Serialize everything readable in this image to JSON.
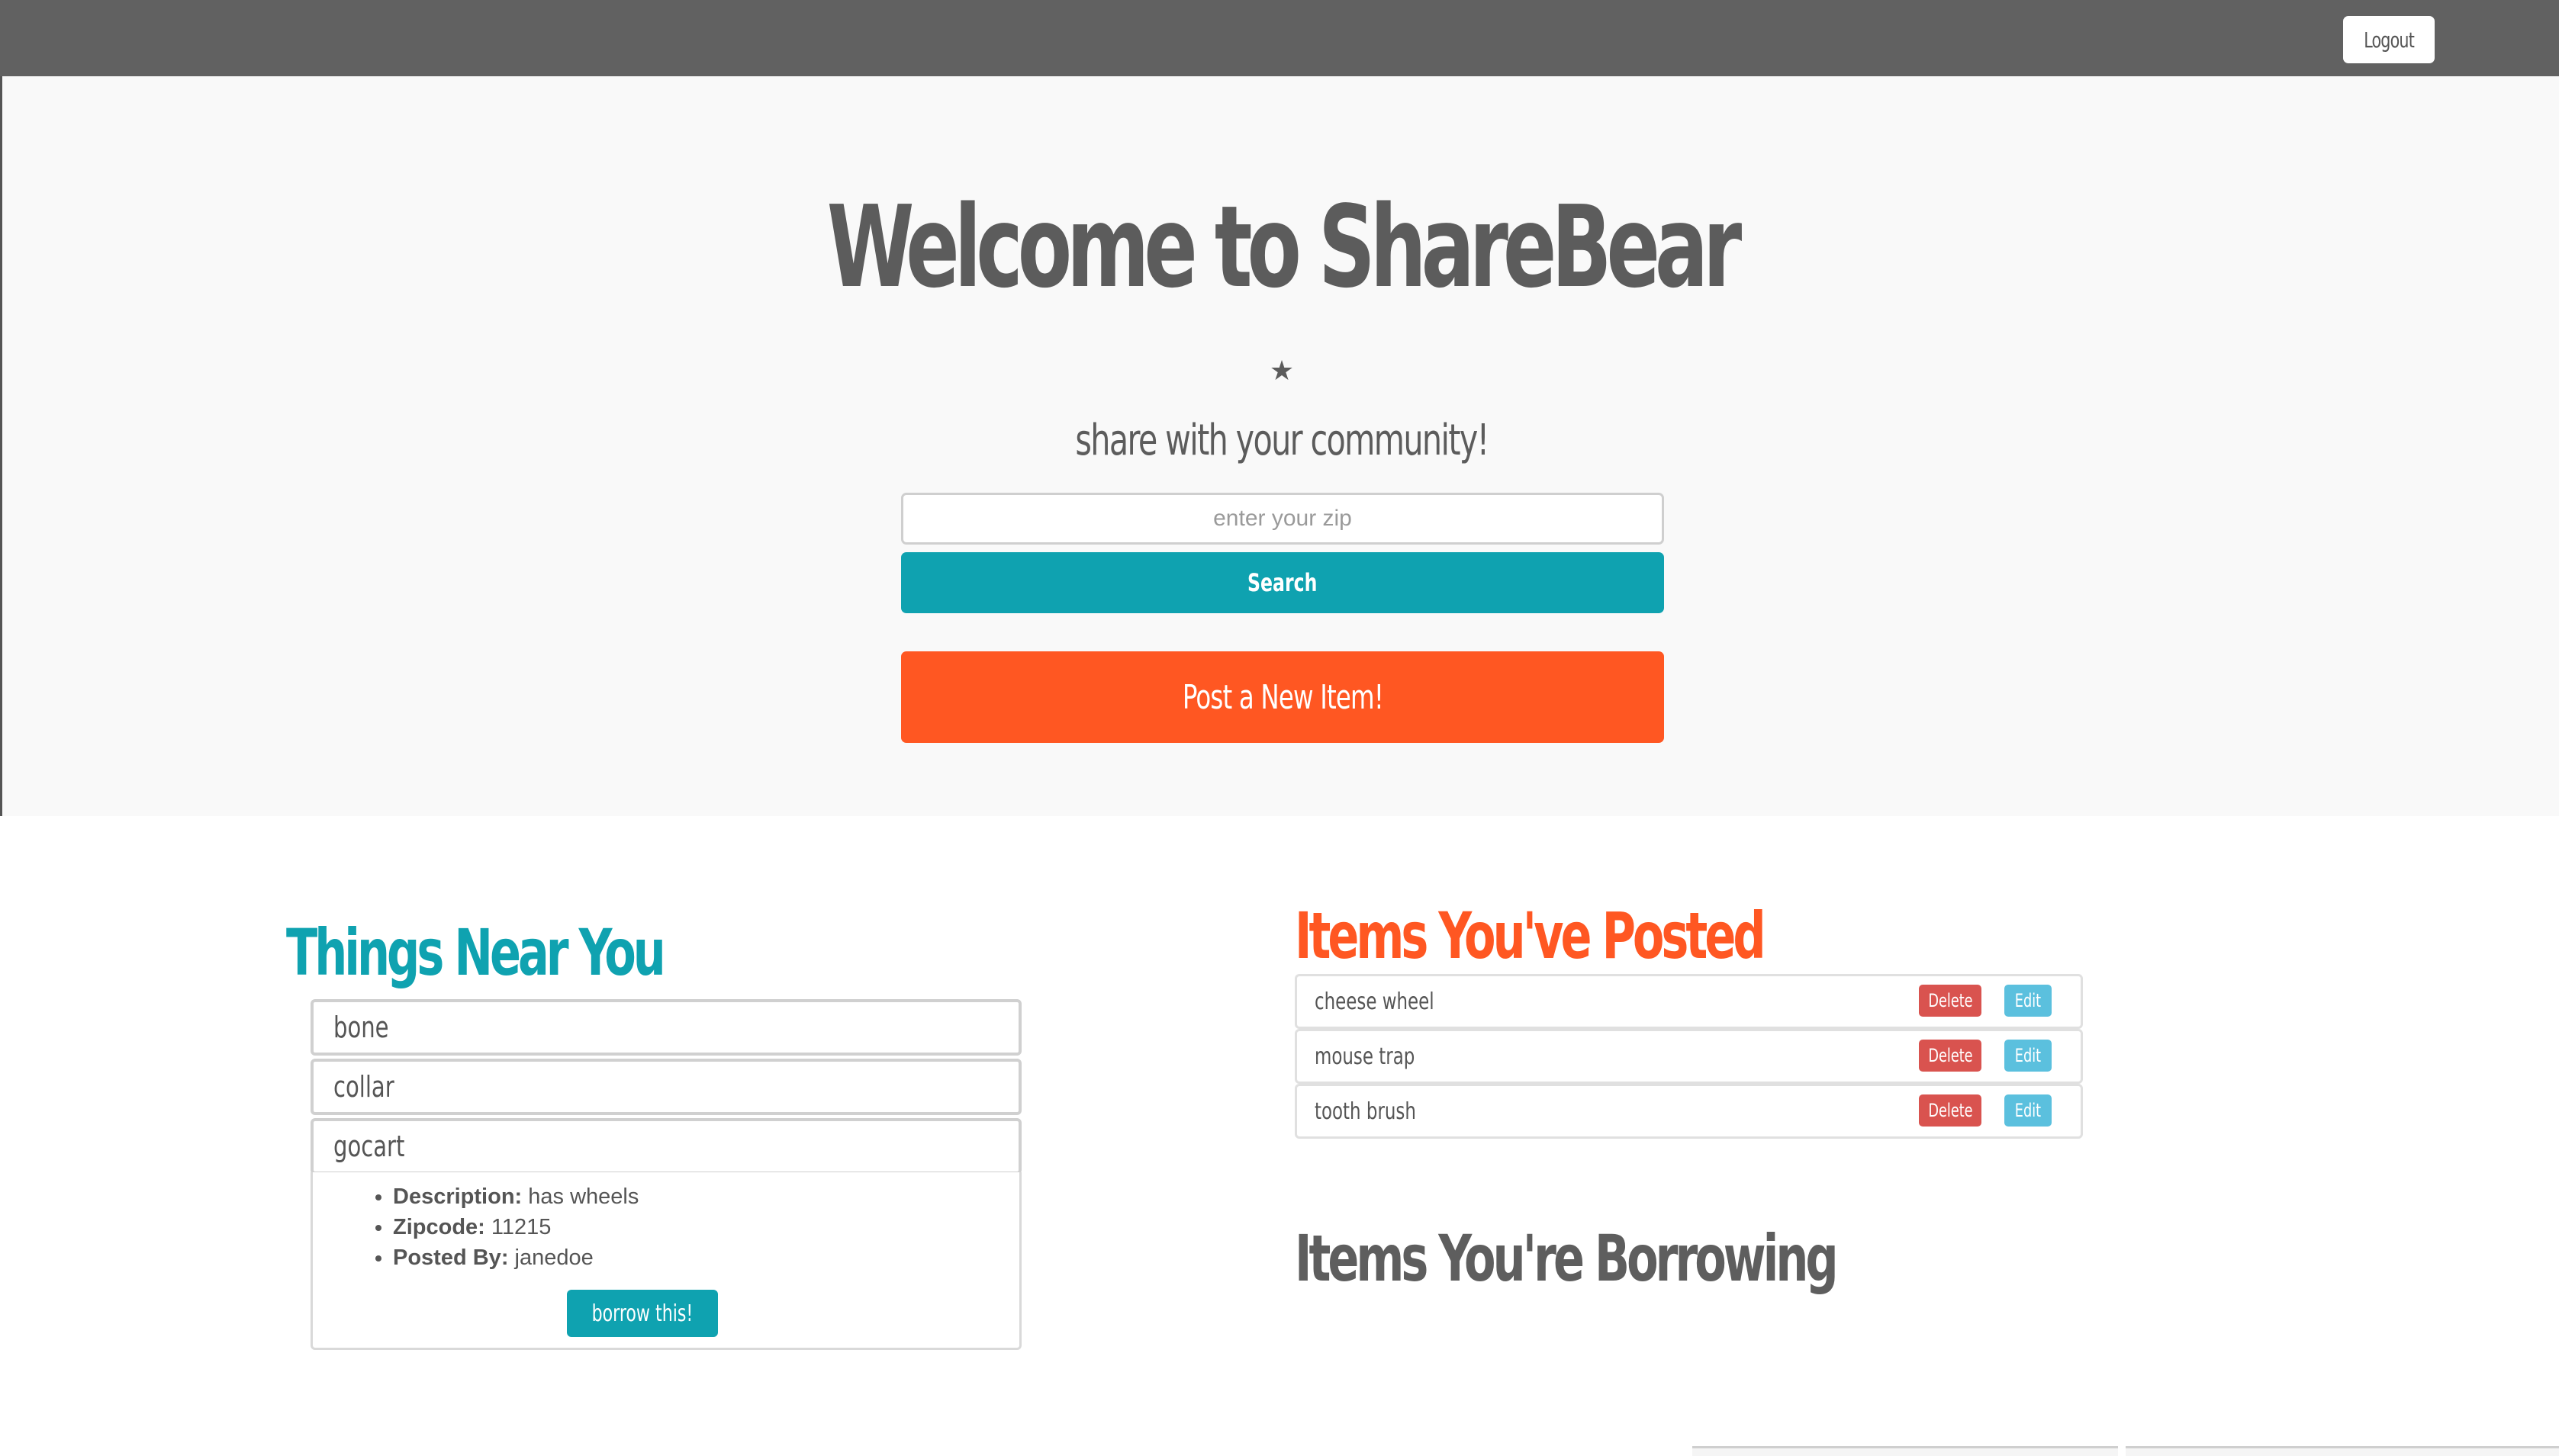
{
  "navbar": {
    "logout_label": "Logout"
  },
  "hero": {
    "title": "Welcome to ShareBear",
    "star": "★",
    "tagline": "share with your community!",
    "zip_placeholder": "enter your zip",
    "search_label": "Search",
    "post_label": "Post a New Item!"
  },
  "near": {
    "title": "Things Near You",
    "items": [
      {
        "name": "bone"
      },
      {
        "name": "collar"
      },
      {
        "name": "gocart"
      }
    ],
    "expanded": {
      "description_label": "Description:",
      "description_value": "has wheels",
      "zipcode_label": "Zipcode:",
      "zipcode_value": "11215",
      "posted_by_label": "Posted By:",
      "posted_by_value": "janedoe",
      "borrow_label": "borrow this!"
    }
  },
  "posted": {
    "title": "Items You've Posted",
    "delete_label": "Delete",
    "edit_label": "Edit",
    "items": [
      {
        "name": "cheese wheel"
      },
      {
        "name": "mouse trap"
      },
      {
        "name": "tooth brush"
      }
    ]
  },
  "borrowing": {
    "title": "Items You're Borrowing"
  },
  "colors": {
    "navbar": "#616161",
    "accent_teal": "#0fa2b0",
    "accent_orange": "#ff5722",
    "delete_red": "#d9534f",
    "edit_blue": "#5bc0de"
  }
}
